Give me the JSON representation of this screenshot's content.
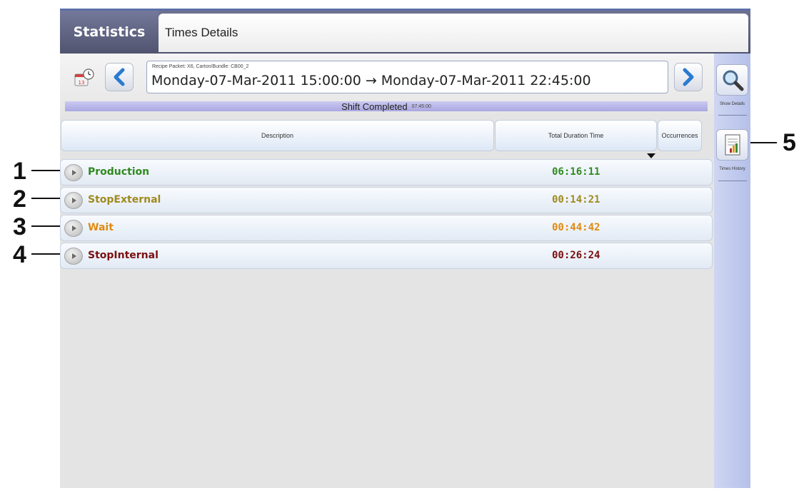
{
  "header": {
    "active_tab": "Statistics",
    "title_tab": "Times Details"
  },
  "range": {
    "recipe_label": "Recipe Packet: X6, Carton/Bundle: CB00_2",
    "text": "Monday-07-Mar-2011 15:00:00 → Monday-07-Mar-2011 22:45:00",
    "icons": {
      "calendar": "calendar-clock-icon",
      "prev": "chevron-left-icon",
      "next": "chevron-right-icon",
      "dropdown": "chevron-down-icon"
    }
  },
  "shift": {
    "status": "Shift Completed",
    "duration": "07:45:00"
  },
  "table": {
    "columns": [
      "Description",
      "Total Duration Time",
      "Occurrences"
    ],
    "rows": [
      {
        "label": "Production",
        "duration": "06:16:11",
        "color": "#2f8a1e"
      },
      {
        "label": "StopExternal",
        "duration": "00:14:21",
        "color": "#a08a1e"
      },
      {
        "label": "Wait",
        "duration": "00:44:42",
        "color": "#e08a10"
      },
      {
        "label": "StopInternal",
        "duration": "00:26:24",
        "color": "#7a1010"
      }
    ]
  },
  "sidebar": {
    "show_details": "Show Details",
    "times_history": "Times History"
  },
  "callouts": [
    "1",
    "2",
    "3",
    "4",
    "5"
  ]
}
